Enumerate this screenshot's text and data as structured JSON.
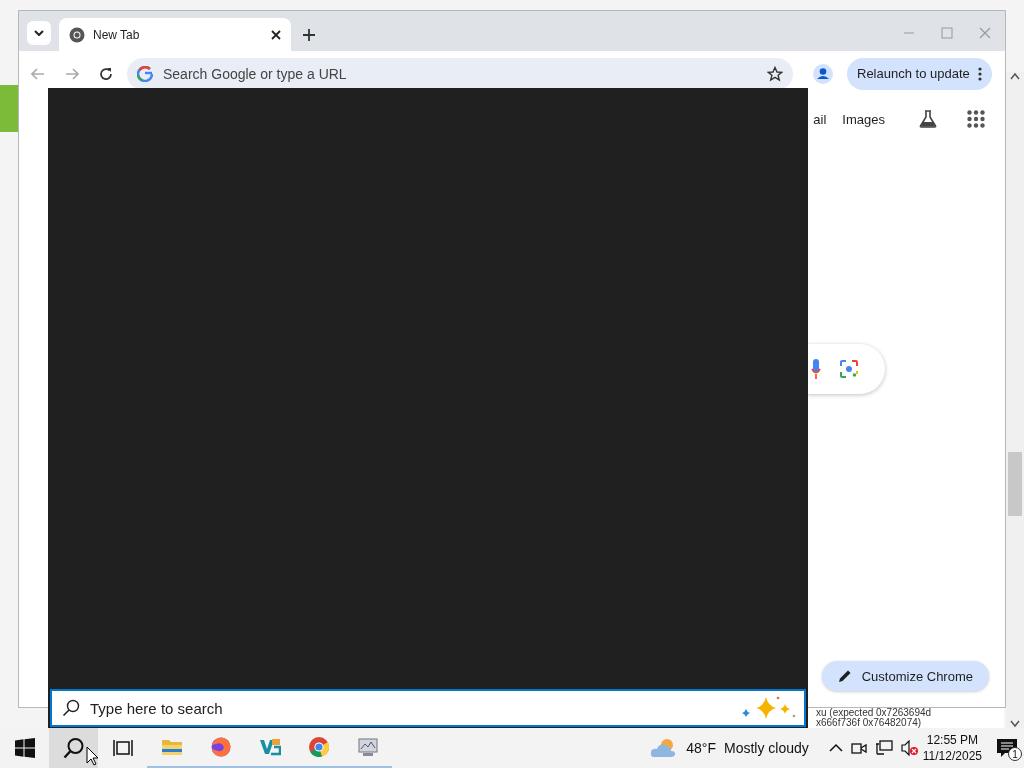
{
  "browser": {
    "tabs": [
      {
        "title": "New Tab",
        "selected": true
      }
    ],
    "omnibox": {
      "placeholder": "Search Google or type a URL"
    },
    "relaunch_button": "Relaunch to update"
  },
  "new_tab_page": {
    "links": [
      "ail",
      "Images"
    ],
    "customize_button": "Customize Chrome"
  },
  "background_text": [
    "xu (expected 0x7263694d",
    "x666f736f 0x76482074)"
  ],
  "search_panel": {
    "placeholder": "Type here to search"
  },
  "taskbar": {
    "weather": {
      "temperature": "48°F",
      "condition": "Mostly cloudy"
    },
    "time": "12:55 PM",
    "date": "11/12/2025",
    "notification_count": "1"
  }
}
